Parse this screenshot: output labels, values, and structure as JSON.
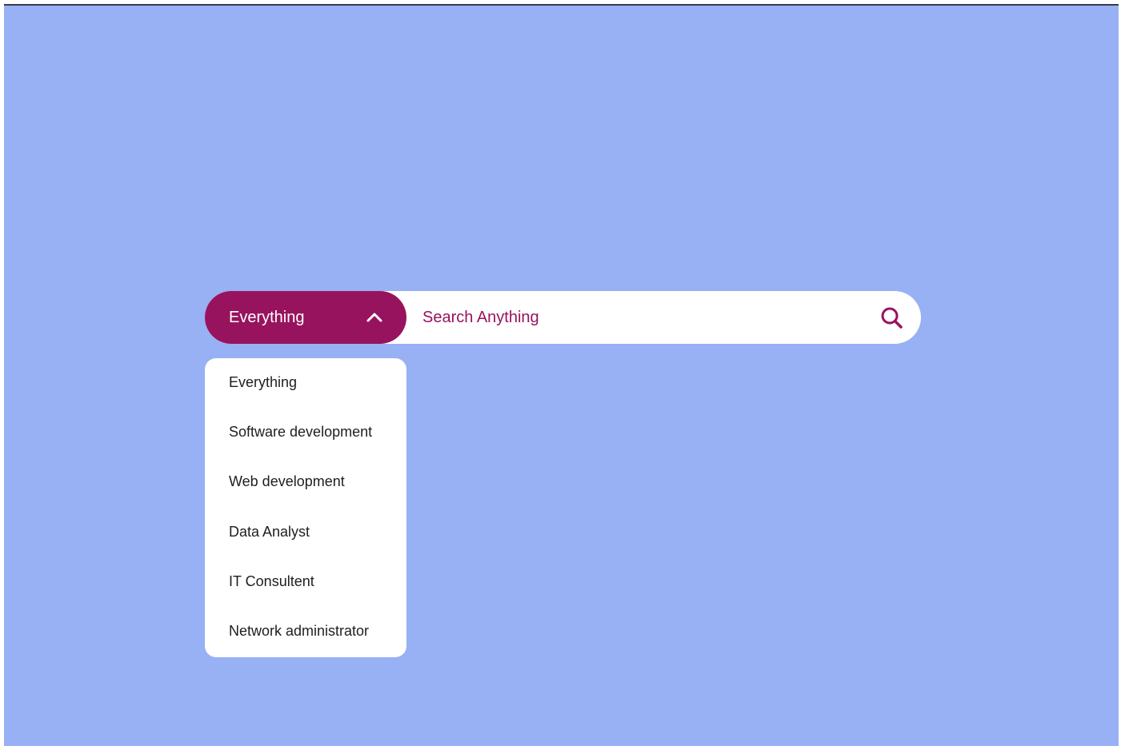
{
  "search": {
    "category_selected": "Everything",
    "placeholder": "Search Anything",
    "value": ""
  },
  "dropdown": {
    "items": [
      {
        "label": "Everything"
      },
      {
        "label": "Software development"
      },
      {
        "label": "Web development"
      },
      {
        "label": "Data Analyst"
      },
      {
        "label": "IT Consultent"
      },
      {
        "label": "Network administrator"
      }
    ]
  },
  "colors": {
    "background": "#98b0f4",
    "accent": "#98135e",
    "surface": "#ffffff",
    "item_text": "#1e1e1e"
  },
  "icons": {
    "category_toggle": "chevron-up-icon",
    "search": "search-icon"
  }
}
